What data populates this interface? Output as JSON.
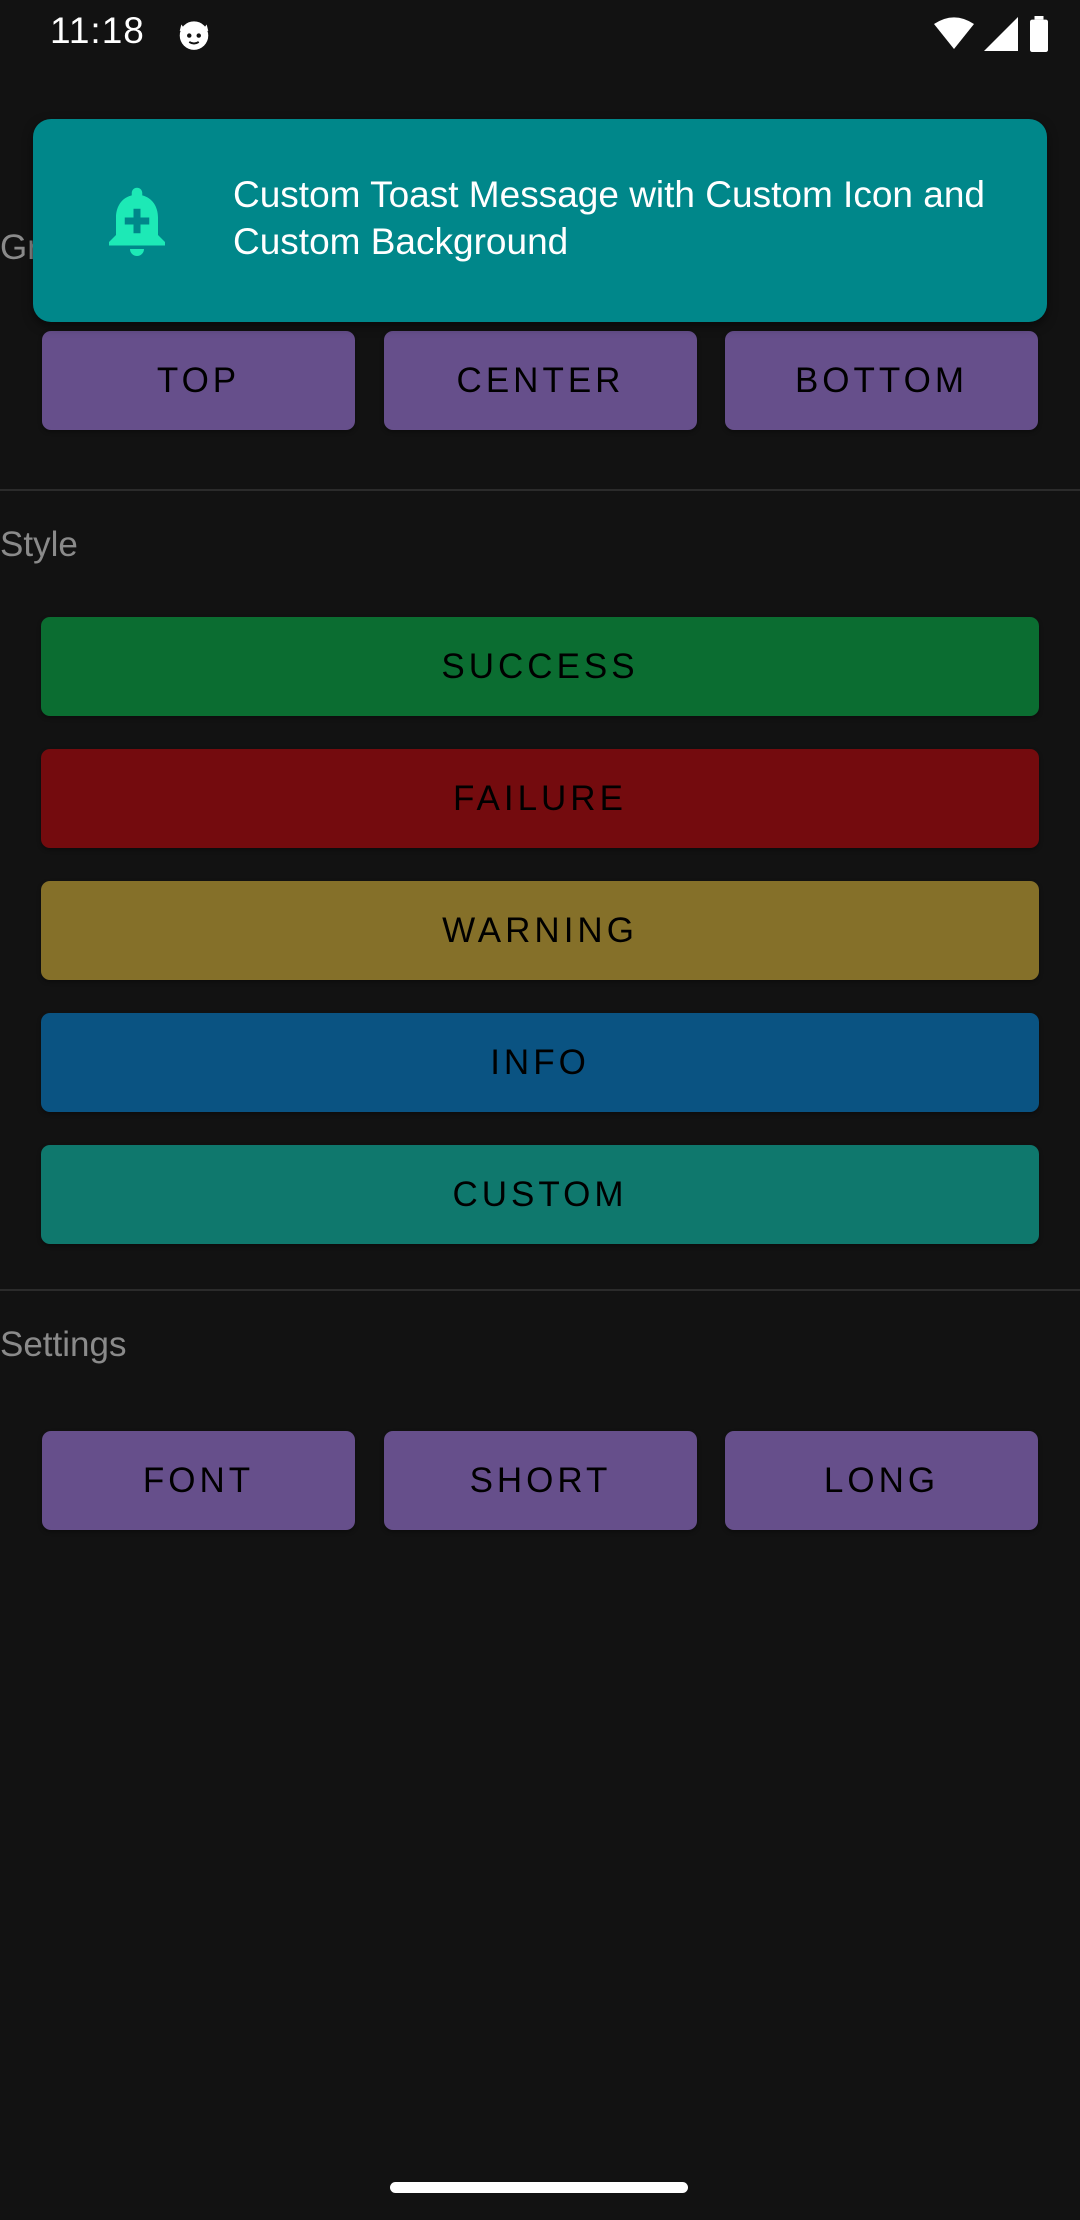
{
  "status_bar": {
    "time": "11:18",
    "app_icon": "cat-face-icon",
    "wifi_icon": "wifi-icon",
    "signal_icon": "cell-signal-icon",
    "battery_icon": "battery-icon"
  },
  "sections": {
    "gravity_label_partial": "Gr",
    "style_label": "Style",
    "settings_label": "Settings"
  },
  "gravity_buttons": {
    "top": "TOP",
    "center": "CENTER",
    "bottom": "BOTTOM"
  },
  "style_buttons": {
    "success": "SUCCESS",
    "failure": "FAILURE",
    "warning": "WARNING",
    "info": "INFO",
    "custom": "CUSTOM"
  },
  "settings_buttons": {
    "font": "FONT",
    "short": "SHORT",
    "long": "LONG"
  },
  "toast": {
    "icon": "bell-plus-icon",
    "message": "Custom Toast Message with Custom Icon and Custom Background"
  },
  "colors": {
    "background": "#121212",
    "purple_button": "#664f8b",
    "success": "#0b6d31",
    "failure": "#740b0e",
    "warning": "#857029",
    "info": "#0a5382",
    "custom": "#0f786d",
    "toast_background": "#00878a",
    "toast_icon": "#1de9b6"
  }
}
